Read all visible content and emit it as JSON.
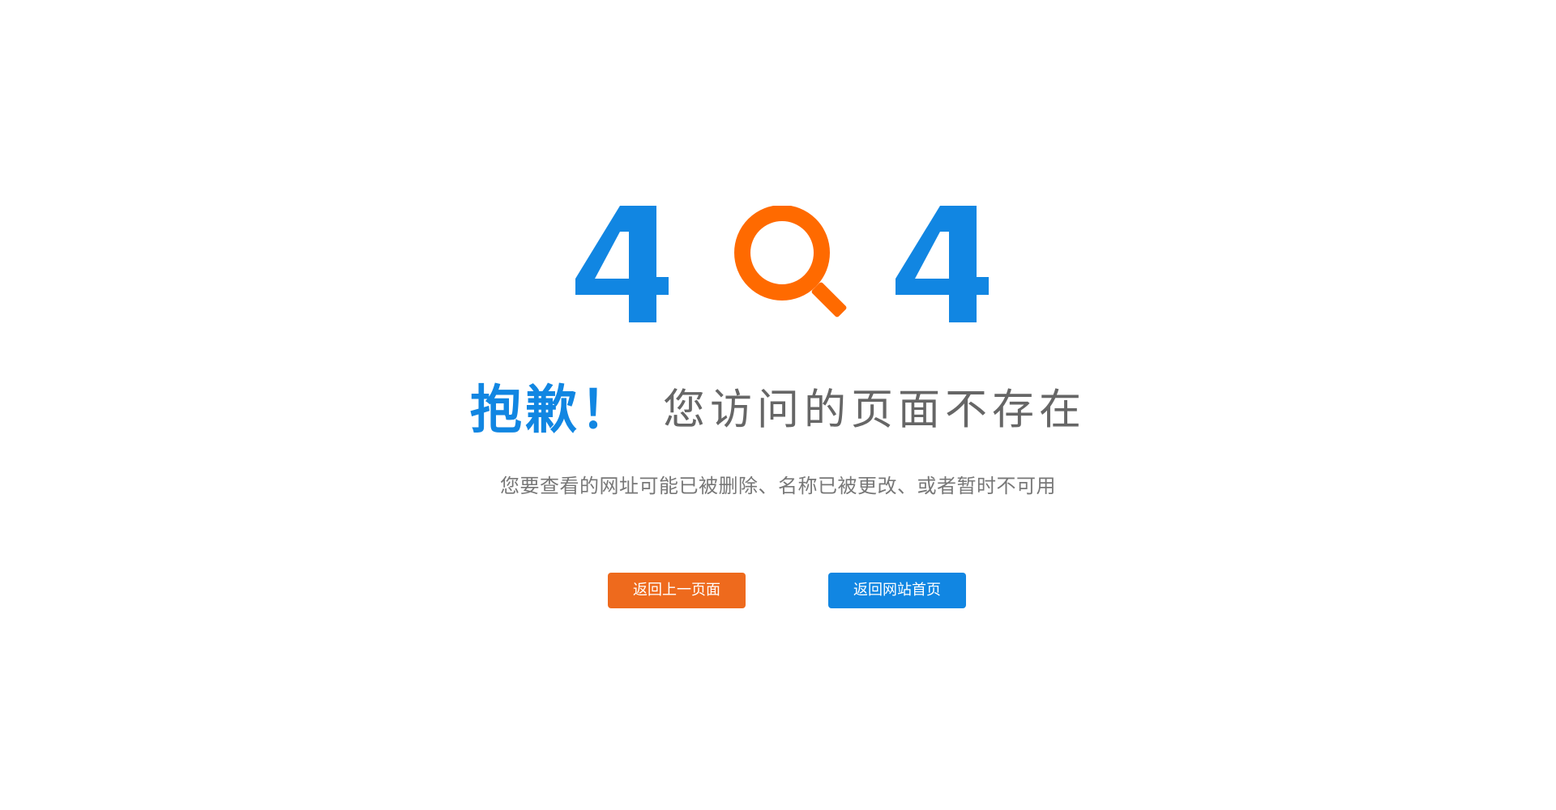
{
  "error": {
    "code_left_digit": "4",
    "code_right_digit": "4",
    "magnifier_icon": "search-icon",
    "colors": {
      "blue": "#1186e2",
      "orange": "#ff6a00",
      "gray_text": "#666666"
    }
  },
  "headline": {
    "sorry": "抱歉！",
    "message": "您访问的页面不存在"
  },
  "subtitle": "您要查看的网址可能已被删除、名称已被更改、或者暂时不可用",
  "buttons": {
    "back": {
      "label": "返回上一页面",
      "color": "#ee6a1d"
    },
    "home": {
      "label": "返回网站首页",
      "color": "#1186e2"
    }
  }
}
